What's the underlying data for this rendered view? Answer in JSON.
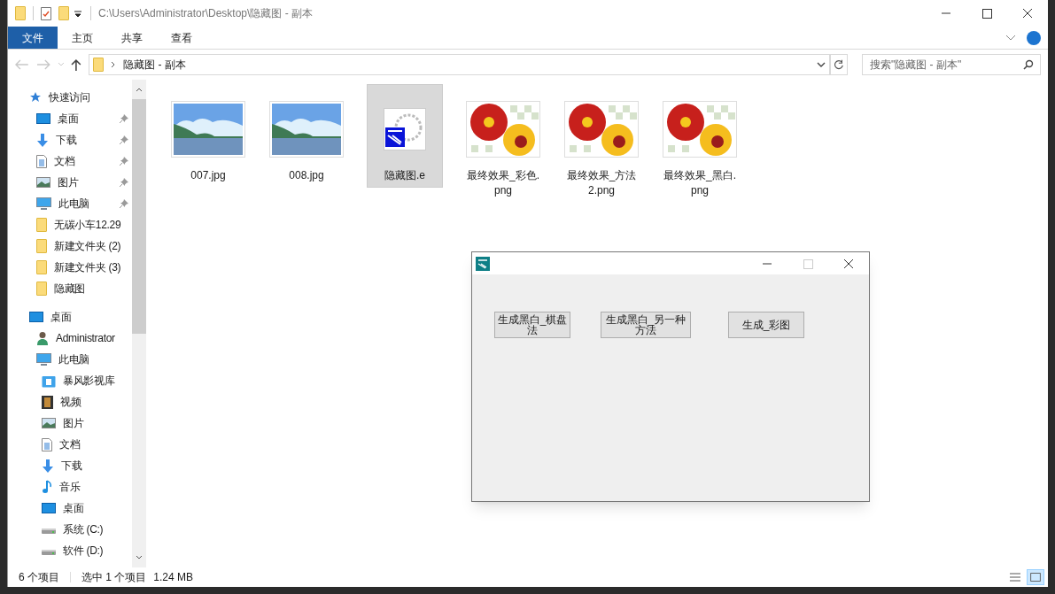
{
  "window": {
    "title": "C:\\Users\\Administrator\\Desktop\\隐藏图 - 副本"
  },
  "ribbon_tabs": [
    {
      "label": "文件",
      "selected": true
    },
    {
      "label": "主页",
      "selected": false
    },
    {
      "label": "共享",
      "selected": false
    },
    {
      "label": "查看",
      "selected": false
    }
  ],
  "address": {
    "path": "隐藏图 - 副本"
  },
  "search": {
    "placeholder": "搜索\"隐藏图 - 副本\""
  },
  "sidebar": {
    "items": [
      {
        "label": "快速访问",
        "kind": "star",
        "pinned": false,
        "children": [
          {
            "label": "桌面",
            "kind": "desktop",
            "pinned": true
          },
          {
            "label": "下载",
            "kind": "download",
            "pinned": true
          },
          {
            "label": "文档",
            "kind": "document",
            "pinned": true
          },
          {
            "label": "图片",
            "kind": "picture",
            "pinned": true
          },
          {
            "label": "此电脑",
            "kind": "pc",
            "pinned": true
          },
          {
            "label": "无碳小车12.29",
            "kind": "folder",
            "pinned": false
          },
          {
            "label": "新建文件夹 (2)",
            "kind": "folder",
            "pinned": false
          },
          {
            "label": "新建文件夹 (3)",
            "kind": "folder",
            "pinned": false
          },
          {
            "label": "隐藏图",
            "kind": "folder",
            "pinned": false
          }
        ]
      },
      {
        "label": "桌面",
        "kind": "desktop",
        "pinned": false,
        "children": [
          {
            "label": "Administrator",
            "kind": "user",
            "pinned": false
          },
          {
            "label": "此电脑",
            "kind": "pc",
            "pinned": false,
            "children": [
              {
                "label": "暴风影视库",
                "kind": "library",
                "pinned": false
              },
              {
                "label": "视频",
                "kind": "video",
                "pinned": false
              },
              {
                "label": "图片",
                "kind": "picture",
                "pinned": false
              },
              {
                "label": "文档",
                "kind": "document",
                "pinned": false
              },
              {
                "label": "下载",
                "kind": "download",
                "pinned": false
              },
              {
                "label": "音乐",
                "kind": "music",
                "pinned": false
              },
              {
                "label": "桌面",
                "kind": "desktop",
                "pinned": false
              },
              {
                "label": "系统 (C:)",
                "kind": "drive",
                "pinned": false
              },
              {
                "label": "软件 (D:)",
                "kind": "drive",
                "pinned": false
              }
            ]
          }
        ]
      }
    ]
  },
  "files": [
    {
      "name": "007.jpg",
      "kind": "landscape",
      "selected": false
    },
    {
      "name": "008.jpg",
      "kind": "landscape",
      "selected": false
    },
    {
      "name": "隐藏图.e",
      "kind": "app",
      "selected": true
    },
    {
      "name": "最终效果_彩色.png",
      "kind": "flower",
      "selected": false
    },
    {
      "name": "最终效果_方法2.png",
      "kind": "flower",
      "selected": false
    },
    {
      "name": "最终效果_黑白.png",
      "kind": "flower",
      "selected": false
    }
  ],
  "status_bar": {
    "count": "6 个项目",
    "selection": "选中 1 个项目",
    "size": "1.24 MB"
  },
  "dialog": {
    "buttons": [
      "生成黑白_棋盘法",
      "生成黑白_另一种方法",
      "生成_彩图"
    ]
  }
}
